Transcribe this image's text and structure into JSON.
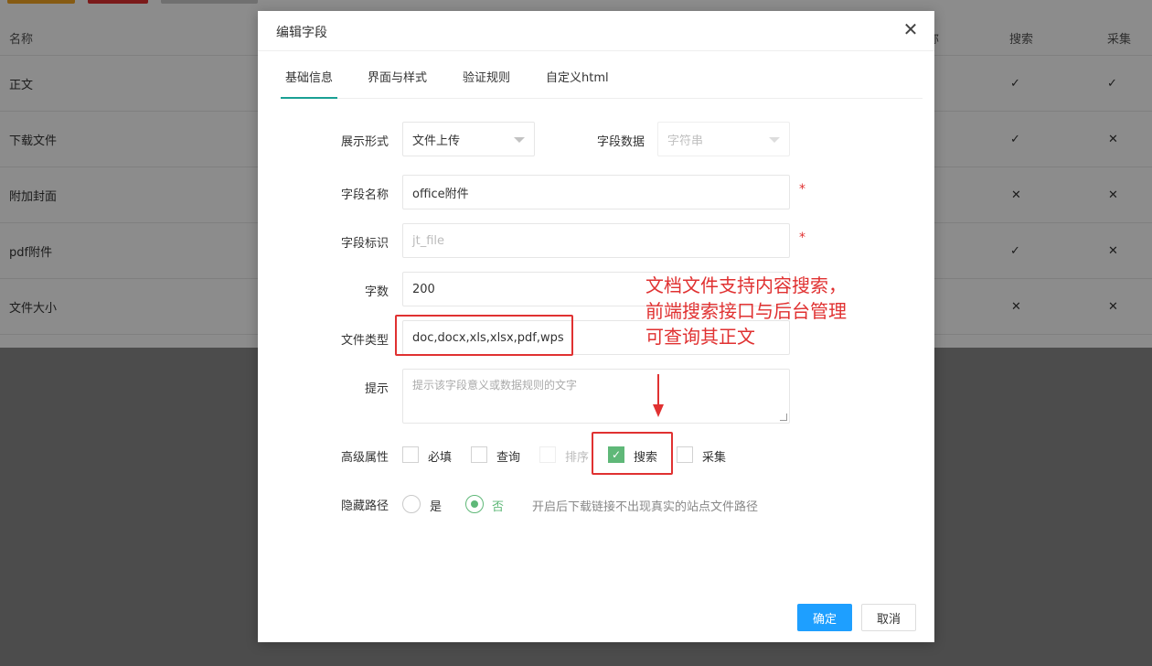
{
  "background": {
    "columns": {
      "name": "名称",
      "search": "搜索",
      "collect": "采集",
      "partial": "称"
    },
    "rows": [
      {
        "name": "正文",
        "search": "tick",
        "collect": "tick"
      },
      {
        "name": "下载文件",
        "search": "tick",
        "collect": "cross"
      },
      {
        "name": "附加封面",
        "search": "cross",
        "collect": "cross"
      },
      {
        "name": "pdf附件",
        "search": "tick",
        "collect": "cross"
      },
      {
        "name": "文件大小",
        "search": "cross",
        "collect": "cross"
      }
    ],
    "tick_char": "✓",
    "cross_char": "✕"
  },
  "modal": {
    "title": "编辑字段",
    "close_char": "✕",
    "tabs": [
      "基础信息",
      "界面与样式",
      "验证规则",
      "自定义html"
    ],
    "active_tab": 0,
    "form": {
      "display_label": "展示形式",
      "display_value": "文件上传",
      "data_label": "字段数据",
      "data_value": "字符串",
      "name_label": "字段名称",
      "name_value": "office附件",
      "id_label": "字段标识",
      "id_value": "jt_file",
      "count_label": "字数",
      "count_value": "200",
      "filetype_label": "文件类型",
      "filetype_value": "doc,docx,xls,xlsx,pdf,wps",
      "tip_label": "提示",
      "tip_placeholder": "提示该字段意义或数据规则的文字",
      "required_mark": "*",
      "advanced_label": "高级属性",
      "advanced_options": [
        {
          "label": "必填",
          "checked": false,
          "disabled": false
        },
        {
          "label": "查询",
          "checked": false,
          "disabled": false
        },
        {
          "label": "排序",
          "checked": false,
          "disabled": true
        },
        {
          "label": "搜索",
          "checked": true,
          "disabled": false
        },
        {
          "label": "采集",
          "checked": false,
          "disabled": false
        }
      ],
      "hide_path_label": "隐藏路径",
      "hide_path_options": [
        {
          "label": "是",
          "checked": false
        },
        {
          "label": "否",
          "checked": true
        }
      ],
      "hide_path_hint": "开启后下载链接不出现真实的站点文件路径",
      "check_char": "✓"
    },
    "buttons": {
      "confirm": "确定",
      "cancel": "取消"
    }
  },
  "annotation": {
    "text_line1": "文档文件支持内容搜索，",
    "text_line2": "前端搜索接口与后台管理",
    "text_line3": "可查询其正文"
  },
  "colors": {
    "accent_green": "#5fb878",
    "primary_blue": "#1e9fff",
    "annotation_red": "#e03131",
    "tab_underline": "#1aa094"
  }
}
